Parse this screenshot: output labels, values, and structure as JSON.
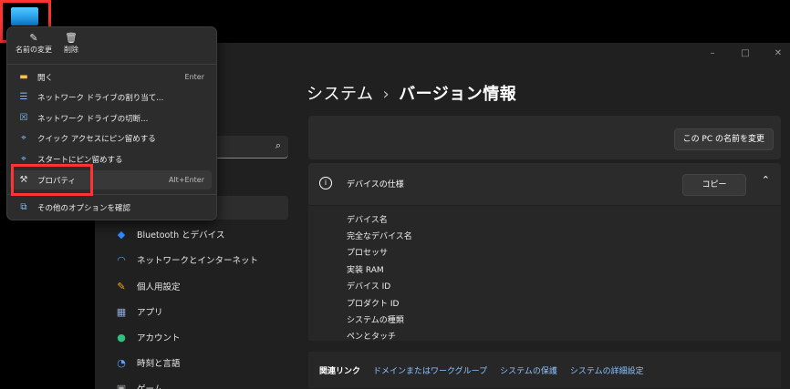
{
  "window": {
    "breadcrumb_parent": "システム",
    "breadcrumb_separator": "›",
    "page_title": "バージョン情報",
    "controls": [
      "–",
      "□",
      "✕"
    ]
  },
  "sidebar": {
    "search_icon": "search-icon",
    "items": [
      {
        "label": "Bluetooth とデバイス",
        "icon": "bluetooth-icon",
        "color": "#2f8cff"
      },
      {
        "label": "ネットワークとインターネット",
        "icon": "wifi-icon",
        "color": "#3fa9ff"
      },
      {
        "label": "個人用設定",
        "icon": "brush-icon",
        "color": "#f5a623"
      },
      {
        "label": "アプリ",
        "icon": "apps-icon",
        "color": "#8aa8d8"
      },
      {
        "label": "アカウント",
        "icon": "account-icon",
        "color": "#2ec27e"
      },
      {
        "label": "時刻と言語",
        "icon": "globe-clock-icon",
        "color": "#58a6ff"
      },
      {
        "label": "ゲーム",
        "icon": "game-icon",
        "color": "#aaaaaa"
      }
    ]
  },
  "main": {
    "rename_button": "この PC の名前を変更",
    "device_specs": {
      "title": "デバイスの仕様",
      "copy_button": "コピー",
      "rows": [
        "デバイス名",
        "完全なデバイス名",
        "プロセッサ",
        "実装 RAM",
        "デバイス ID",
        "プロダクト ID",
        "システムの種類",
        "ペンとタッチ"
      ]
    },
    "related": {
      "label": "関連リンク",
      "links": [
        "ドメインまたはワークグループ",
        "システムの保護",
        "システムの詳細設定"
      ]
    }
  },
  "context_menu": {
    "top_actions": [
      {
        "label": "名前の変更",
        "icon": "rename-icon"
      },
      {
        "label": "削除",
        "icon": "trash-icon"
      }
    ],
    "items": [
      {
        "label": "開く",
        "shortcut": "Enter",
        "icon": "folder-icon"
      },
      {
        "label": "ネットワーク ドライブの割り当て...",
        "shortcut": "",
        "icon": "network-drive-icon"
      },
      {
        "label": "ネットワーク ドライブの切断...",
        "shortcut": "",
        "icon": "disconnect-drive-icon"
      },
      {
        "label": "クイック アクセスにピン留めする",
        "shortcut": "",
        "icon": "pin-icon"
      },
      {
        "label": "スタートにピン留めする",
        "shortcut": "",
        "icon": "pin-start-icon"
      },
      {
        "label": "プロパティ",
        "shortcut": "Alt+Enter",
        "icon": "wrench-icon"
      },
      {
        "label": "その他のオプションを確認",
        "shortcut": "",
        "icon": "more-options-icon"
      }
    ]
  },
  "colors": {
    "highlight": "#ff3333",
    "link": "#8cc2ff"
  }
}
